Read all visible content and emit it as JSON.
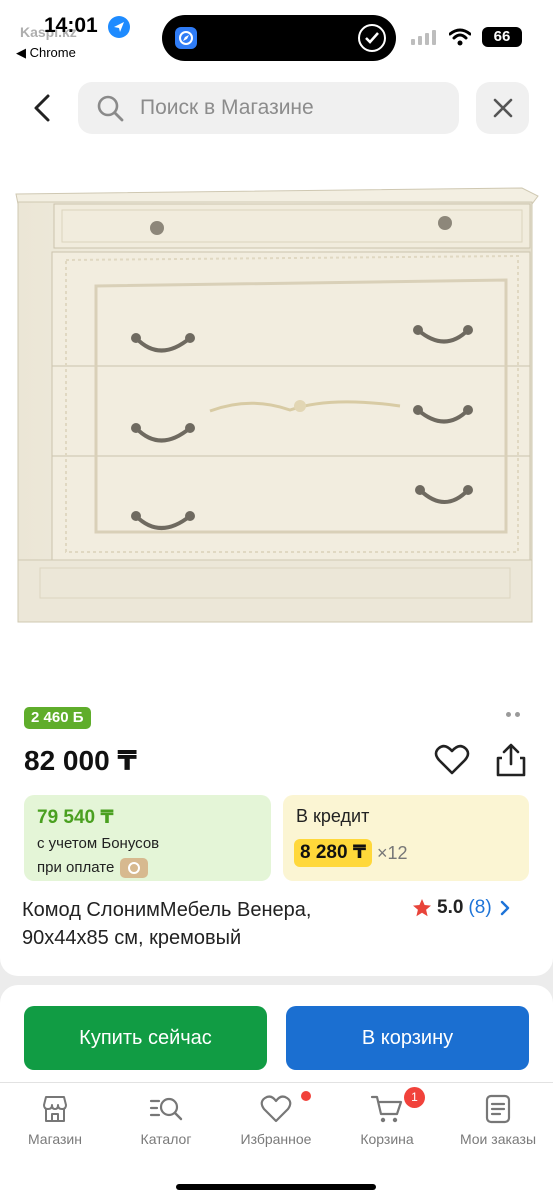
{
  "status_bar": {
    "time": "14:01",
    "ghost_text": "Kaspi.kz",
    "back_app": "◀ Chrome",
    "battery": "66"
  },
  "header": {
    "search_placeholder": "Поиск в Магазине"
  },
  "product": {
    "bonus_badge": "2 460 Б",
    "price": "82 000 ₸",
    "bonus_box": {
      "price": "79 540 ₸",
      "line1": "с учетом Бонусов",
      "line2": "при оплате"
    },
    "credit_box": {
      "title": "В кредит",
      "amount": "8 280 ₸",
      "multiplier": "×12"
    },
    "title": "Комод СлонимМебель Венера, 90x44x85 см, кремовый",
    "rating": "5.0",
    "reviews": "(8)"
  },
  "actions": {
    "buy_now": "Купить сейчас",
    "add_to_cart": "В корзину"
  },
  "tabbar": {
    "items": [
      {
        "label": "Магазин",
        "icon": "store-icon"
      },
      {
        "label": "Каталог",
        "icon": "catalog-search-icon"
      },
      {
        "label": "Избранное",
        "icon": "heart-icon"
      },
      {
        "label": "Корзина",
        "icon": "cart-icon"
      },
      {
        "label": "Мои заказы",
        "icon": "orders-icon"
      }
    ],
    "cart_badge": "1"
  },
  "colors": {
    "green_accent": "#119c44",
    "blue_accent": "#1b6fd1",
    "bonus_green": "#5fad2b",
    "credit_yellow": "#ffd83a",
    "badge_red": "#f1423b"
  }
}
